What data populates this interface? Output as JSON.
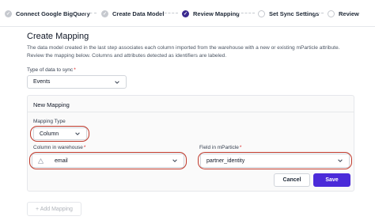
{
  "stepper": {
    "steps": [
      {
        "label": "Connect Google BigQuery",
        "state": "done"
      },
      {
        "label": "Create Data Model",
        "state": "done"
      },
      {
        "label": "Review Mapping",
        "state": "current"
      },
      {
        "label": "Set Sync Settings",
        "state": "future"
      },
      {
        "label": "Review",
        "state": "future"
      }
    ]
  },
  "page": {
    "title": "Create Mapping",
    "description": "The data model created in the last step associates each column imported from the warehouse with a new or existing mParticle attribute. Review the mapping below. Columns and attributes detected as identifiers are labeled."
  },
  "type_of_data": {
    "label": "Type of data to sync",
    "required_mark": "*",
    "value": "Events"
  },
  "mapping": {
    "title": "New Mapping",
    "mapping_type": {
      "label": "Mapping Type",
      "value": "Column"
    },
    "column": {
      "label": "Column in warehouse",
      "required_mark": "*",
      "value": "email",
      "icon": "warning-triangle-icon"
    },
    "field": {
      "label": "Field in mParticle",
      "required_mark": "*",
      "value": "partner_identity"
    },
    "cancel_label": "Cancel",
    "save_label": "Save"
  },
  "add_mapping_label": "+ Add Mapping",
  "colors": {
    "accent": "#4b2bd9",
    "current_step": "#3b2a8f",
    "highlight": "#c0392b"
  }
}
